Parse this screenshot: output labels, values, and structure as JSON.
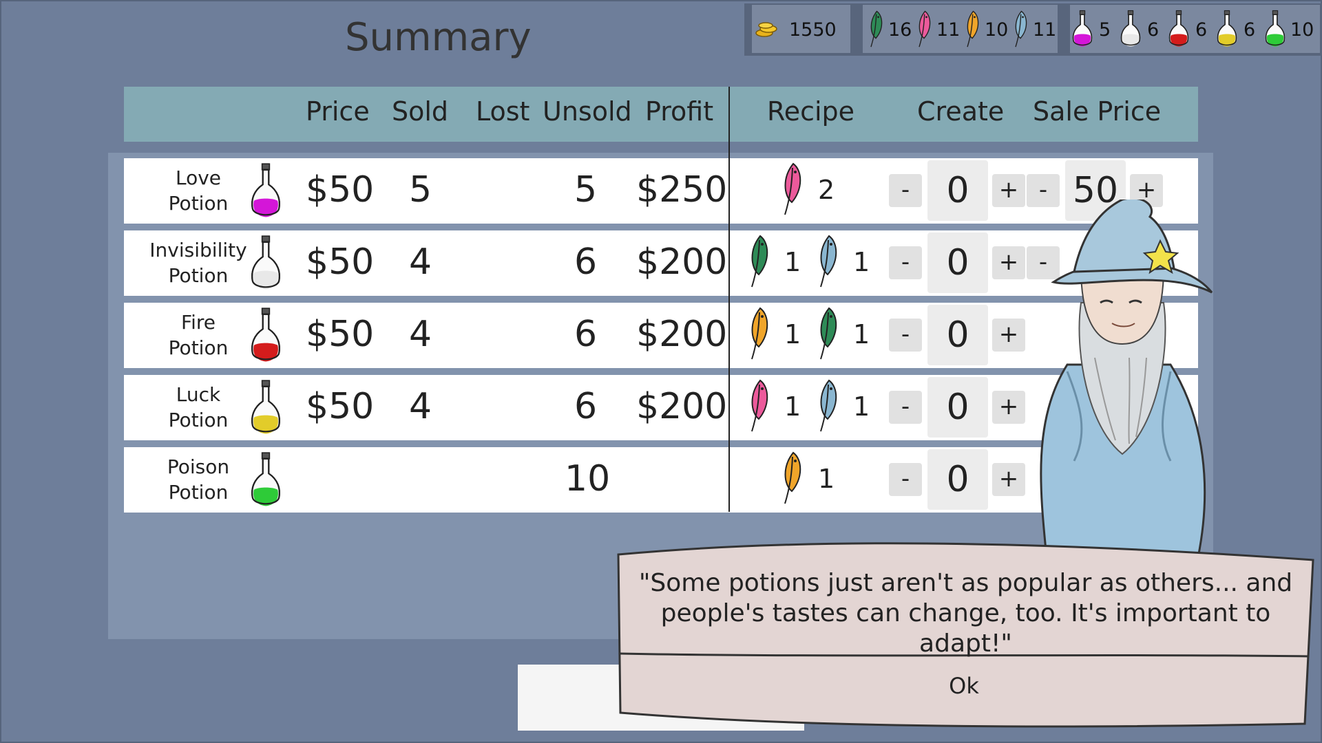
{
  "title": "Summary",
  "resources": {
    "gold": "1550",
    "feathers": [
      {
        "color": "green",
        "count": "16"
      },
      {
        "color": "pink",
        "count": "11"
      },
      {
        "color": "orange",
        "count": "10"
      },
      {
        "color": "blue",
        "count": "11"
      }
    ],
    "potions": [
      {
        "color": "magenta",
        "count": "5"
      },
      {
        "color": "white",
        "count": "6"
      },
      {
        "color": "red",
        "count": "6"
      },
      {
        "color": "yellow",
        "count": "6"
      },
      {
        "color": "green",
        "count": "10"
      }
    ]
  },
  "headers": {
    "price": "Price",
    "sold": "Sold",
    "lost": "Lost",
    "unsold": "Unsold",
    "profit": "Profit",
    "recipe": "Recipe",
    "create": "Create",
    "sale_price": "Sale Price"
  },
  "rows": [
    {
      "name1": "Love",
      "name2": "Potion",
      "price": "$50",
      "sold": "5",
      "lost": "",
      "unsold": "5",
      "profit": "$250",
      "recipe": [
        {
          "color": "pink",
          "qty": "2"
        }
      ],
      "create": "0",
      "sale_price": "50"
    },
    {
      "name1": "Invisibility",
      "name2": "Potion",
      "price": "$50",
      "sold": "4",
      "lost": "",
      "unsold": "6",
      "profit": "$200",
      "recipe": [
        {
          "color": "green",
          "qty": "1"
        },
        {
          "color": "blue",
          "qty": "1"
        }
      ],
      "create": "0",
      "sale_price": ""
    },
    {
      "name1": "Fire",
      "name2": "Potion",
      "price": "$50",
      "sold": "4",
      "lost": "",
      "unsold": "6",
      "profit": "$200",
      "recipe": [
        {
          "color": "orange",
          "qty": "1"
        },
        {
          "color": "green",
          "qty": "1"
        }
      ],
      "create": "0",
      "sale_price": ""
    },
    {
      "name1": "Luck",
      "name2": "Potion",
      "price": "$50",
      "sold": "4",
      "lost": "",
      "unsold": "6",
      "profit": "$200",
      "recipe": [
        {
          "color": "pink",
          "qty": "1"
        },
        {
          "color": "blue",
          "qty": "1"
        }
      ],
      "create": "0",
      "sale_price": ""
    },
    {
      "name1": "Poison",
      "name2": "Potion",
      "price": "",
      "sold": "",
      "lost": "",
      "unsold": "10",
      "profit": "",
      "recipe": [
        {
          "color": "orange",
          "qty": "1"
        }
      ],
      "create": "0",
      "sale_price": ""
    }
  ],
  "buttons": {
    "minus": "-",
    "plus": "+"
  },
  "dialog": {
    "line1": "\"Some potions just aren't as popular as others... and",
    "line2": "people's tastes can change, too. It's important to adapt!\"",
    "ok": "Ok"
  },
  "colors": {
    "background": "#6e7e9a",
    "header": "#84aab4",
    "feather_green": "#2e8b57",
    "feather_pink": "#ec5a9b",
    "feather_orange": "#f0a52a",
    "feather_blue": "#8ab6d0",
    "potion_magenta": "#d416d8",
    "potion_white": "#e8e8e8",
    "potion_red": "#d41c1c",
    "potion_yellow": "#e2cc2a",
    "potion_green": "#2ecb38"
  }
}
